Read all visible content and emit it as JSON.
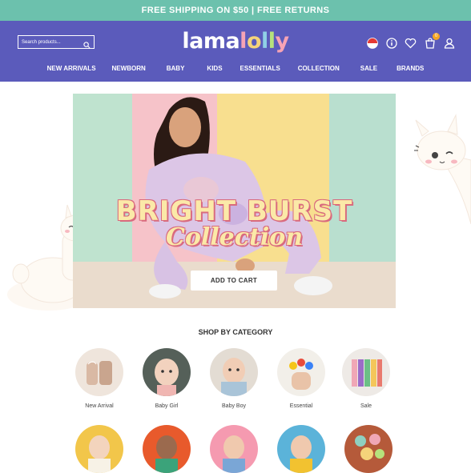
{
  "promo": {
    "text": "FREE SHIPPING ON $50 | FREE RETURNS"
  },
  "header": {
    "search_placeholder": "Search products...",
    "logo_parts": [
      "lama",
      "l",
      "o",
      "l",
      "l",
      "y"
    ],
    "cart_count": "0",
    "nav": [
      "NEW ARRIVALS",
      "NEWBORN",
      "BABY",
      "KIDS",
      "ESSENTIALS",
      "COLLECTION",
      "SALE",
      "BRANDS"
    ]
  },
  "hero": {
    "title_line1": "BRIGHT BURST",
    "title_line2": "Collection",
    "cta": "ADD TO CART"
  },
  "categories": {
    "title": "SHOP BY CATEGORY",
    "row1": [
      "New Arrival",
      "Baby Girl",
      "Baby Boy",
      "Essential",
      "Sale"
    ]
  },
  "colors": {
    "promo": "#6cc1ad",
    "header": "#5b5bbb",
    "accent": "#f5a623"
  }
}
